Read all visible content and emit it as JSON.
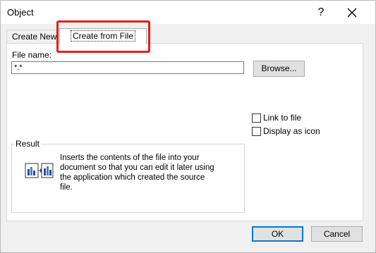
{
  "window": {
    "title": "Object",
    "help_glyph": "?"
  },
  "tabs": [
    {
      "label": "Create New",
      "active": false
    },
    {
      "label": "Create from File",
      "active": true
    }
  ],
  "file": {
    "label": "File name:",
    "value": "*.*",
    "browse_label": "Browse..."
  },
  "options": {
    "link_label": "Link to file",
    "link_checked": false,
    "icon_label": "Display as icon",
    "icon_checked": false
  },
  "result": {
    "legend": "Result",
    "line1": "Inserts the contents of the file into your",
    "line2": "document so that you can edit it later using",
    "line3": "the application which created the source",
    "line4": "file."
  },
  "buttons": {
    "ok": "OK",
    "cancel": "Cancel"
  },
  "colors": {
    "highlight": "#e02020",
    "focus_border": "#0078d7"
  }
}
